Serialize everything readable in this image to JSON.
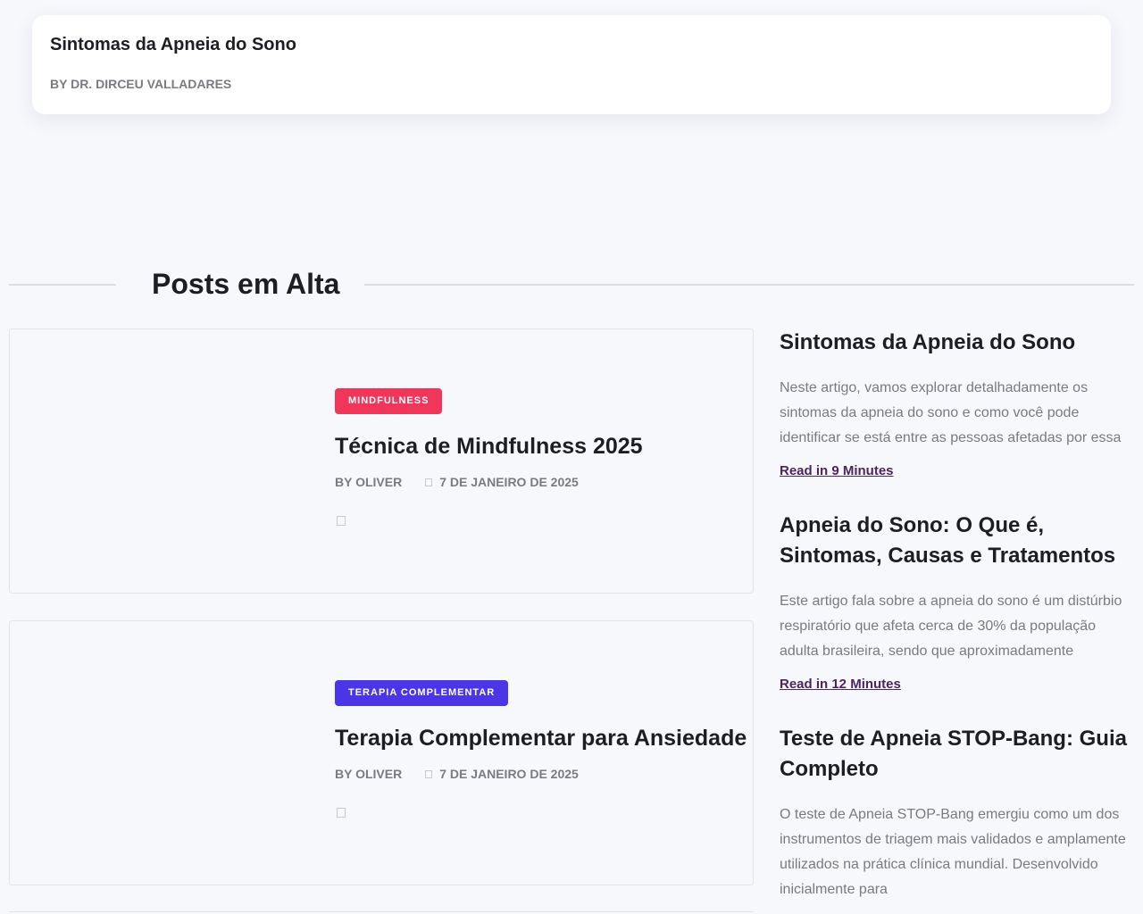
{
  "top_card": {
    "title": "Sintomas da Apneia do Sono",
    "author": "BY DR. DIRCEU VALLADARES"
  },
  "section": {
    "title": "Posts em Alta"
  },
  "posts": [
    {
      "category": "MINDFULNESS",
      "category_color": "#f0365b",
      "title": "Técnica de Mindfulness 2025",
      "author": "BY OLIVER",
      "date": "7 DE JANEIRO DE 2025"
    },
    {
      "category": "TERAPIA COMPLEMENTAR",
      "category_color": "#4a35e8",
      "title": "Terapia Complementar para Ansiedade",
      "author": "BY OLIVER",
      "date": "7 DE JANEIRO DE 2025"
    }
  ],
  "sidebar": {
    "items": [
      {
        "title": "Sintomas da Apneia do Sono",
        "excerpt": "Neste artigo, vamos explorar detalhadamente os sintomas da apneia do sono e como você pode identificar se está entre as pessoas afetadas por essa",
        "link": "Read in 9 Minutes"
      },
      {
        "title": "Apneia do Sono: O Que é, Sintomas, Causas e Tratamentos",
        "excerpt": "Este artigo fala sobre a apneia do sono é um distúrbio respiratório que afeta cerca de 30% da população adulta brasileira, sendo que aproximadamente",
        "link": "Read in 12 Minutes"
      },
      {
        "title": "Teste de Apneia STOP-Bang: Guia Completo",
        "excerpt": "O teste de Apneia STOP-Bang emergiu como um dos instrumentos de triagem mais validados e amplamente utilizados na prática clínica mundial. Desenvolvido inicialmente para"
      }
    ]
  },
  "colors": {
    "background": "#f7f8fc",
    "link": "#4b2462"
  }
}
